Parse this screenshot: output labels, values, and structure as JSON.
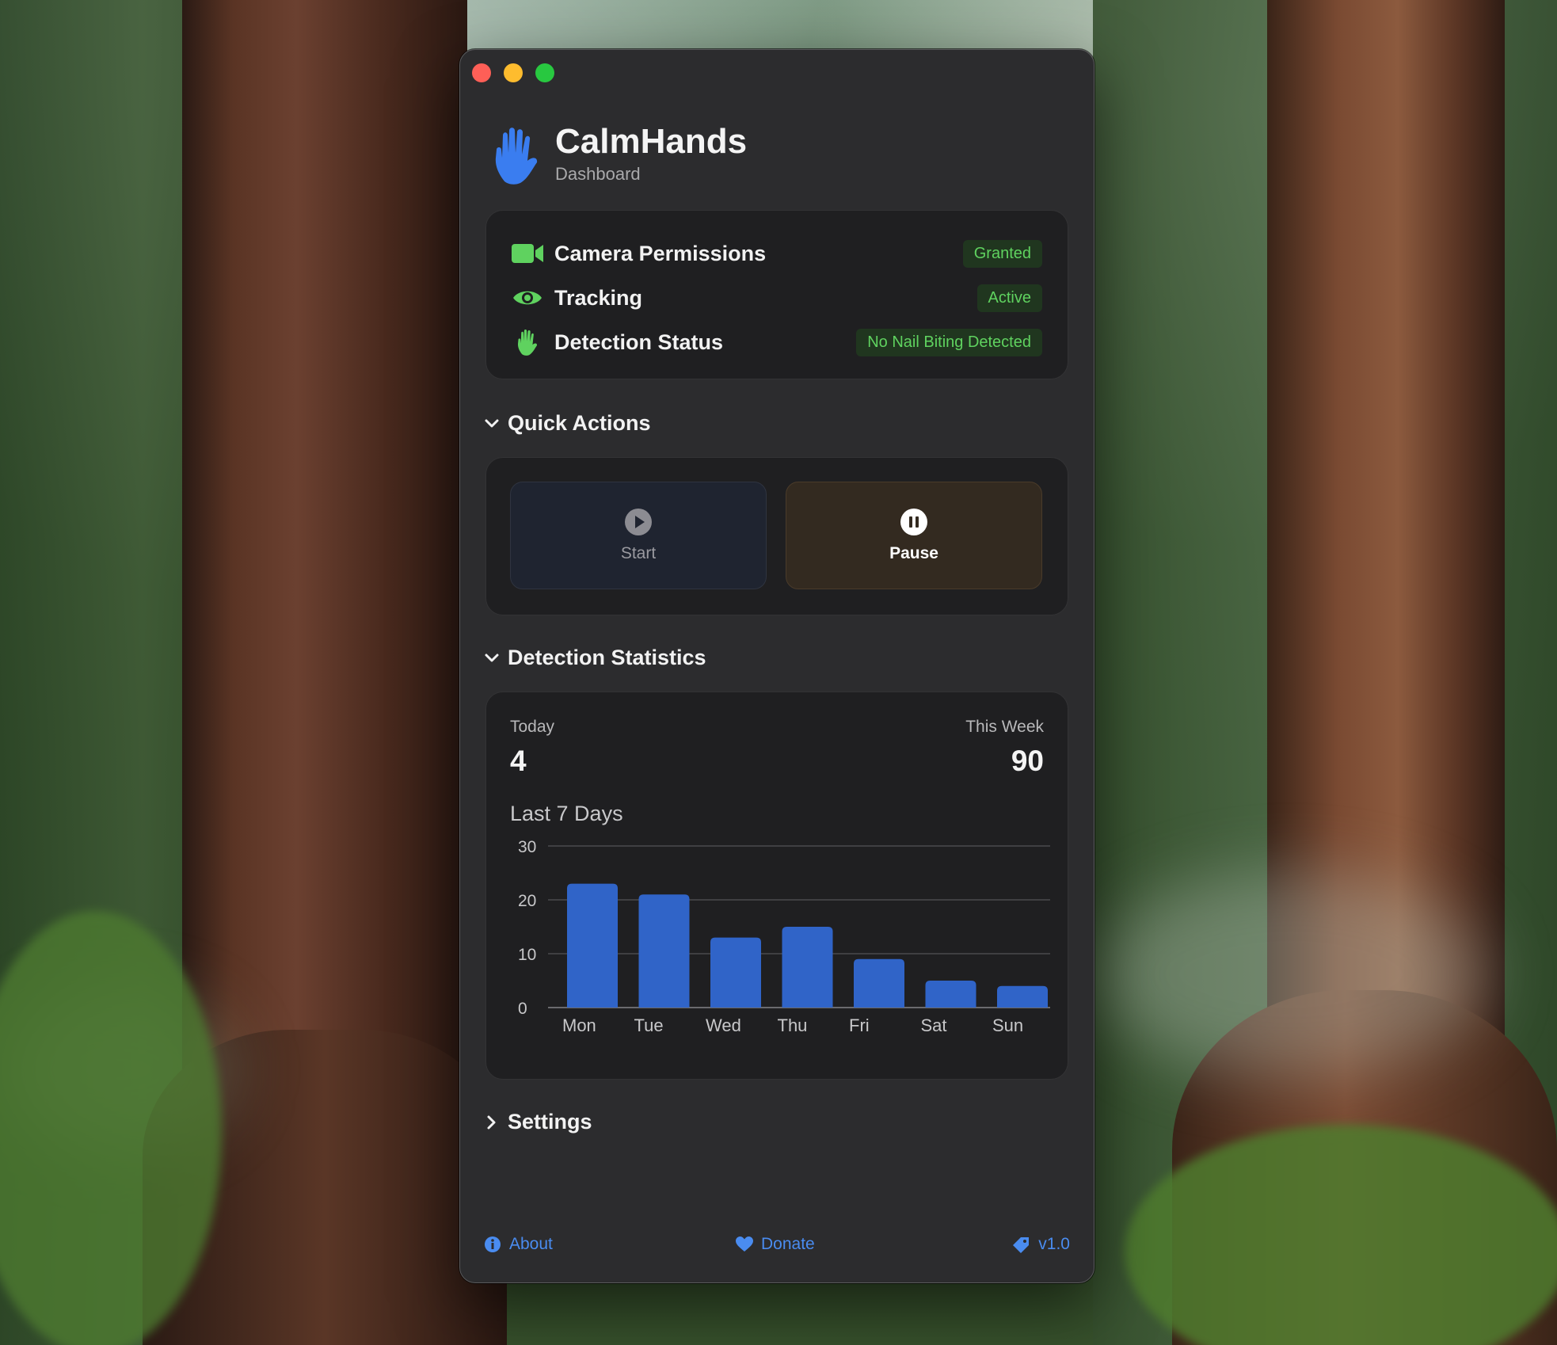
{
  "window": {
    "app_title": "CalmHands",
    "app_subtitle": "Dashboard"
  },
  "status": {
    "items": [
      {
        "icon": "video-camera-icon",
        "label": "Camera Permissions",
        "badge": "Granted"
      },
      {
        "icon": "eye-icon",
        "label": "Tracking",
        "badge": "Active"
      },
      {
        "icon": "hand-icon",
        "label": "Detection Status",
        "badge": "No Nail Biting Detected"
      }
    ]
  },
  "quick_actions": {
    "title": "Quick Actions",
    "start_label": "Start",
    "pause_label": "Pause"
  },
  "statistics": {
    "title": "Detection Statistics",
    "today_label": "Today",
    "today_value": "4",
    "week_label": "This Week",
    "week_value": "90"
  },
  "settings": {
    "title": "Settings"
  },
  "footer": {
    "about": "About",
    "donate": "Donate",
    "version": "v1.0"
  },
  "colors": {
    "accent": "#4a8cf0",
    "bar": "#3064c8",
    "badge_text": "#5fd25f",
    "badge_bg": "#20361f"
  },
  "chart_data": {
    "type": "bar",
    "title": "Last 7 Days",
    "categories": [
      "Mon",
      "Tue",
      "Wed",
      "Thu",
      "Fri",
      "Sat",
      "Sun"
    ],
    "values": [
      23,
      21,
      13,
      15,
      9,
      5,
      4
    ],
    "yticks": [
      0,
      10,
      20,
      30
    ],
    "ylim": [
      0,
      30
    ],
    "grid": true
  }
}
